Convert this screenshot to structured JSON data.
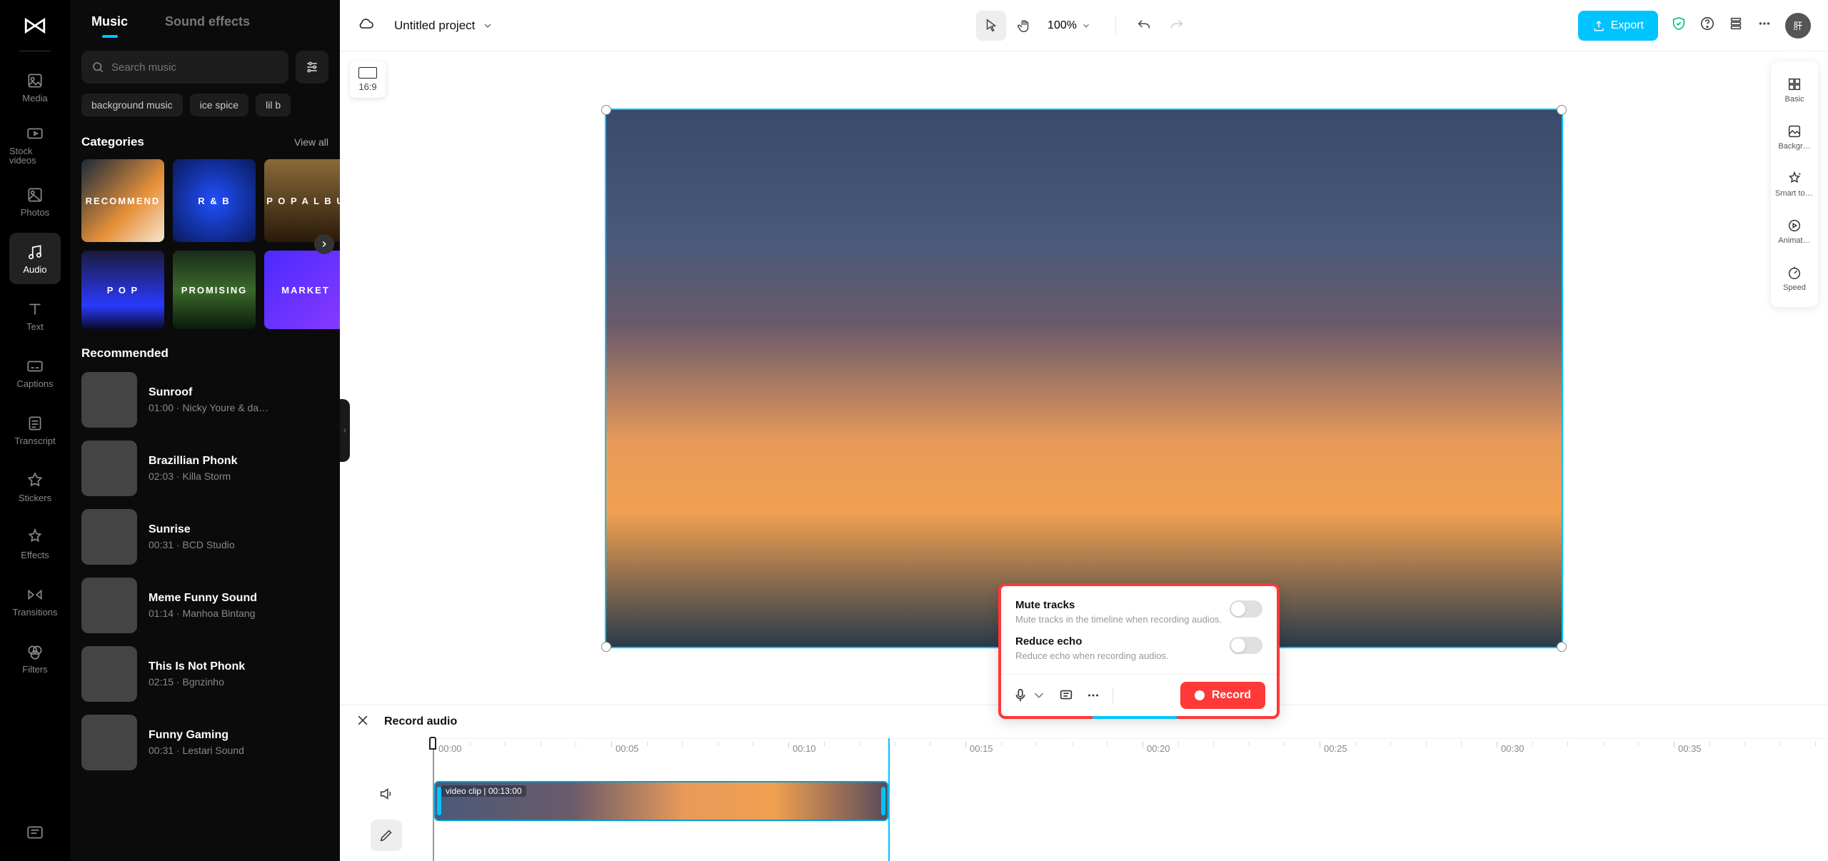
{
  "header": {
    "project_name": "Untitled project",
    "zoom": "100%",
    "export_label": "Export",
    "avatar_initials": "肝"
  },
  "rail": [
    {
      "id": "media",
      "label": "Media"
    },
    {
      "id": "stock",
      "label": "Stock videos"
    },
    {
      "id": "photos",
      "label": "Photos"
    },
    {
      "id": "audio",
      "label": "Audio",
      "active": true
    },
    {
      "id": "text",
      "label": "Text"
    },
    {
      "id": "captions",
      "label": "Captions"
    },
    {
      "id": "transcript",
      "label": "Transcript"
    },
    {
      "id": "stickers",
      "label": "Stickers"
    },
    {
      "id": "effects",
      "label": "Effects"
    },
    {
      "id": "transitions",
      "label": "Transitions"
    },
    {
      "id": "filters",
      "label": "Filters"
    }
  ],
  "audio_panel": {
    "tabs": [
      {
        "label": "Music",
        "active": true
      },
      {
        "label": "Sound effects",
        "active": false
      }
    ],
    "search_placeholder": "Search music",
    "chips": [
      "background music",
      "ice spice",
      "lil b"
    ],
    "categories_title": "Categories",
    "view_all": "View all",
    "categories_row1": [
      {
        "label": "RECOMMEND",
        "cls": "cat-recommend"
      },
      {
        "label": "R & B",
        "cls": "cat-rnb"
      },
      {
        "label": "P O P\nA L B U",
        "cls": "cat-pop-alb"
      }
    ],
    "categories_row2": [
      {
        "label": "P O P",
        "cls": "cat-pop"
      },
      {
        "label": "PROMISING",
        "cls": "cat-promising"
      },
      {
        "label": "MARKET",
        "cls": "cat-market"
      }
    ],
    "recommended_title": "Recommended",
    "tracks": [
      {
        "title": "Sunroof",
        "sub": "01:00 · Nicky Youre & da…",
        "art": "art0"
      },
      {
        "title": "Brazillian Phonk",
        "sub": "02:03 · Killa Storm",
        "art": "art1"
      },
      {
        "title": "Sunrise",
        "sub": "00:31 · BCD Studio",
        "art": "art2"
      },
      {
        "title": "Meme Funny Sound",
        "sub": "01:14 · Manhoa Bintang",
        "art": "art3"
      },
      {
        "title": "This Is Not Phonk",
        "sub": "02:15 · Bgnzinho",
        "art": "art4"
      },
      {
        "title": "Funny Gaming",
        "sub": "00:31 · Lestari Sound",
        "art": "art5"
      }
    ]
  },
  "aspect_badge": "16:9",
  "prop_rail": [
    {
      "id": "basic",
      "label": "Basic"
    },
    {
      "id": "background",
      "label": "Backgr…"
    },
    {
      "id": "smart",
      "label": "Smart tools"
    },
    {
      "id": "animation",
      "label": "Animat…"
    },
    {
      "id": "speed",
      "label": "Speed"
    }
  ],
  "record_pop": {
    "mute_title": "Mute tracks",
    "mute_desc": "Mute tracks in the timeline when recording audios.",
    "echo_title": "Reduce echo",
    "echo_desc": "Reduce echo when recording audios.",
    "record_label": "Record"
  },
  "timeline": {
    "header_title": "Record audio",
    "ticks": [
      "00:00",
      "00:05",
      "00:10",
      "00:15",
      "00:20",
      "00:25",
      "00:30",
      "00:35"
    ],
    "clip_label": "video clip",
    "clip_duration": "00:13:00"
  }
}
